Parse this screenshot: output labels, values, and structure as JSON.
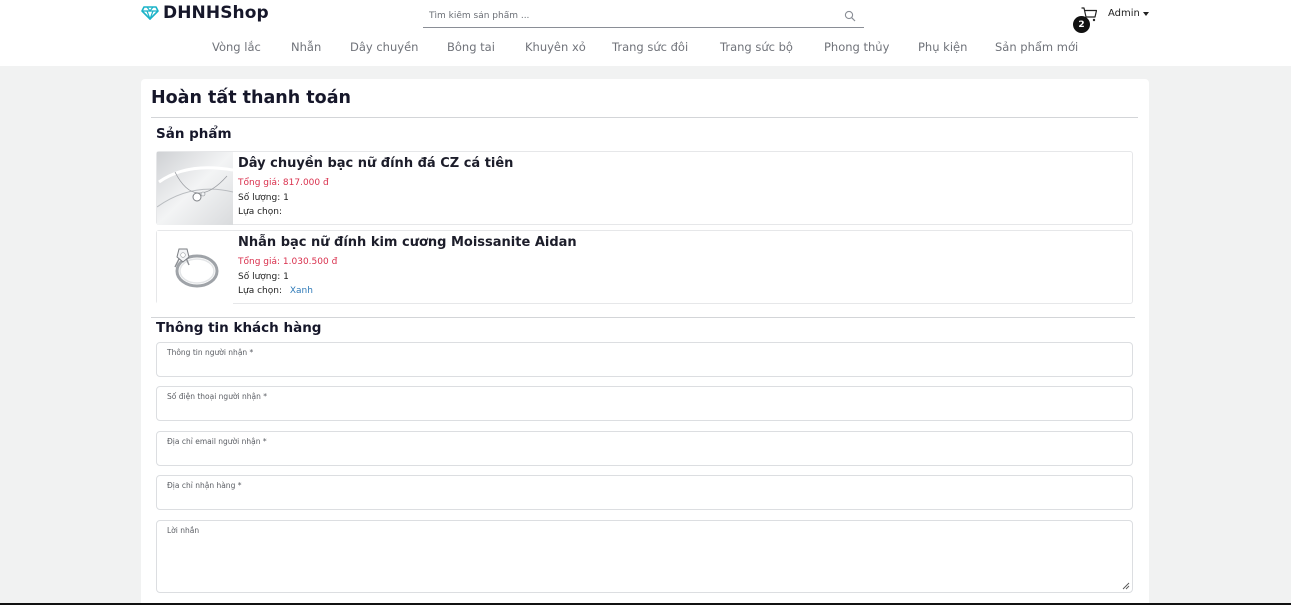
{
  "brand": {
    "name": "DHNHShop",
    "color": "#16172a",
    "logo_icon": "diamond-icon"
  },
  "search": {
    "placeholder": "Tìm kiếm sản phẩm ..."
  },
  "cart": {
    "count": "2"
  },
  "user": {
    "name": "Admin"
  },
  "nav": [
    "Vòng lắc",
    "Nhẫn",
    "Dây chuyền",
    "Bông tai",
    "Khuyên xỏ",
    "Trang sức đôi",
    "Trang sức bộ",
    "Phong thủy",
    "Phụ kiện",
    "Sản phẩm mới"
  ],
  "page": {
    "title": "Hoàn tất thanh toán"
  },
  "products_section": {
    "title": "Sản phẩm"
  },
  "products": [
    {
      "name": "Dây chuyền bạc nữ đính đá CZ cá tiên",
      "price_label": "Tổng giá:",
      "price": "817.000 đ",
      "qty_label": "Số lượng:",
      "qty": "1",
      "option_label": "Lựa chọn:",
      "option": ""
    },
    {
      "name": "Nhẫn bạc nữ đính kim cương Moissanite Aidan",
      "price_label": "Tổng giá:",
      "price": "1.030.500 đ",
      "qty_label": "Số lượng:",
      "qty": "1",
      "option_label": "Lựa chọn:",
      "option": "Xanh"
    }
  ],
  "customer_section": {
    "title": "Thông tin khách hàng"
  },
  "form": {
    "recipient_name": {
      "label": "Thông tin người nhận *",
      "value": ""
    },
    "recipient_phone": {
      "label": "Số điện thoại người nhận *",
      "value": ""
    },
    "recipient_email": {
      "label": "Địa chỉ email người nhận *",
      "value": ""
    },
    "recipient_address": {
      "label": "Địa chỉ nhận hàng *",
      "value": ""
    },
    "message": {
      "label": "Lời nhắn",
      "value": ""
    }
  },
  "colors": {
    "price": "#d9304d",
    "option_link": "#2f7ab8",
    "background": "#f1f2f2"
  }
}
